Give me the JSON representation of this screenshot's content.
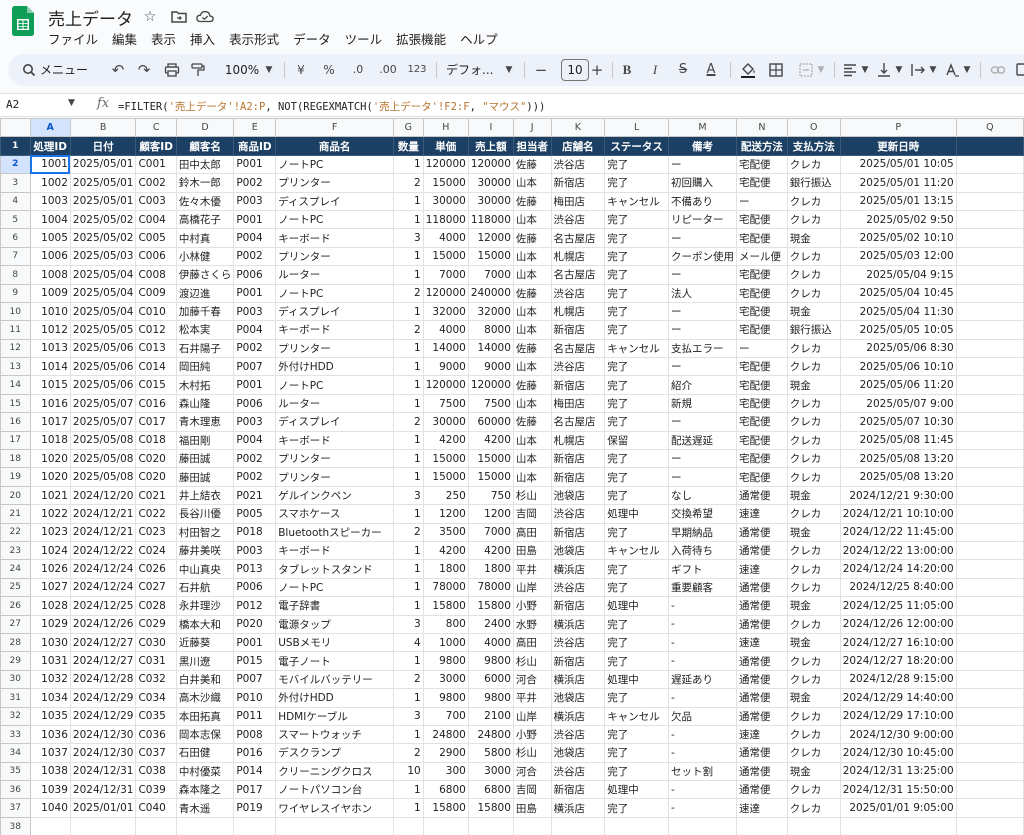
{
  "doc": {
    "title": "売上データ"
  },
  "menu": [
    "ファイル",
    "編集",
    "表示",
    "挿入",
    "表示形式",
    "データ",
    "ツール",
    "拡張機能",
    "ヘルプ"
  ],
  "toolbar": {
    "search_label": "メニュー",
    "zoom": "100%",
    "currency": "¥",
    "percent": "%",
    "dec_decrease": ".0",
    "dec_increase": ".00",
    "format_123": "123",
    "font": "デフォ...",
    "font_size": "10",
    "minus": "−",
    "plus": "+",
    "bold": "B",
    "italic": "I",
    "strike": "S",
    "text_color": "A"
  },
  "formula_bar": {
    "cell_ref": "A2",
    "fx": "fx",
    "formula_prefix": "=FILTER(",
    "formula_ref1": "'売上データ'!A2:P",
    "formula_mid": ", NOT(REGEXMATCH(",
    "formula_ref2": "'売上データ'!F2:F",
    "formula_sep": ", ",
    "formula_str": "\"マウス\"",
    "formula_end": ")))"
  },
  "columns": [
    "A",
    "B",
    "C",
    "D",
    "E",
    "F",
    "G",
    "H",
    "I",
    "J",
    "K",
    "L",
    "M",
    "N",
    "O",
    "P",
    "Q"
  ],
  "header_row": [
    "処理ID",
    "日付",
    "顧客ID",
    "顧客名",
    "商品ID",
    "商品名",
    "数量",
    "単価",
    "売上額",
    "担当者",
    "店舗名",
    "ステータス",
    "備考",
    "配送方法",
    "支払方法",
    "更新日時"
  ],
  "rows": [
    [
      "1001",
      "2025/05/01",
      "C001",
      "田中太郎",
      "P001",
      "ノートPC",
      "1",
      "120000",
      "120000",
      "佐藤",
      "渋谷店",
      "完了",
      "ー",
      "宅配便",
      "クレカ",
      "2025/05/01 10:05"
    ],
    [
      "1002",
      "2025/05/01",
      "C002",
      "鈴木一郎",
      "P002",
      "プリンター",
      "2",
      "15000",
      "30000",
      "山本",
      "新宿店",
      "完了",
      "初回購入",
      "宅配便",
      "銀行振込",
      "2025/05/01 11:20"
    ],
    [
      "1003",
      "2025/05/01",
      "C003",
      "佐々木優",
      "P003",
      "ディスプレイ",
      "1",
      "30000",
      "30000",
      "佐藤",
      "梅田店",
      "キャンセル",
      "不備あり",
      "ー",
      "クレカ",
      "2025/05/01 13:15"
    ],
    [
      "1004",
      "2025/05/02",
      "C004",
      "高橋花子",
      "P001",
      "ノートPC",
      "1",
      "118000",
      "118000",
      "山本",
      "渋谷店",
      "完了",
      "リピーター",
      "宅配便",
      "クレカ",
      "2025/05/02 9:50"
    ],
    [
      "1005",
      "2025/05/02",
      "C005",
      "中村真",
      "P004",
      "キーボード",
      "3",
      "4000",
      "12000",
      "佐藤",
      "名古屋店",
      "完了",
      "ー",
      "宅配便",
      "現金",
      "2025/05/02 10:10"
    ],
    [
      "1006",
      "2025/05/03",
      "C006",
      "小林健",
      "P002",
      "プリンター",
      "1",
      "15000",
      "15000",
      "山本",
      "札幌店",
      "完了",
      "クーポン使用",
      "メール便",
      "クレカ",
      "2025/05/03 12:00"
    ],
    [
      "1008",
      "2025/05/04",
      "C008",
      "伊藤さくら",
      "P006",
      "ルーター",
      "1",
      "7000",
      "7000",
      "山本",
      "名古屋店",
      "完了",
      "ー",
      "宅配便",
      "クレカ",
      "2025/05/04 9:15"
    ],
    [
      "1009",
      "2025/05/04",
      "C009",
      "渡辺進",
      "P001",
      "ノートPC",
      "2",
      "120000",
      "240000",
      "佐藤",
      "渋谷店",
      "完了",
      "法人",
      "宅配便",
      "クレカ",
      "2025/05/04 10:45"
    ],
    [
      "1010",
      "2025/05/04",
      "C010",
      "加藤千春",
      "P003",
      "ディスプレイ",
      "1",
      "32000",
      "32000",
      "山本",
      "札幌店",
      "完了",
      "ー",
      "宅配便",
      "現金",
      "2025/05/04 11:30"
    ],
    [
      "1012",
      "2025/05/05",
      "C012",
      "松本実",
      "P004",
      "キーボード",
      "2",
      "4000",
      "8000",
      "山本",
      "新宿店",
      "完了",
      "ー",
      "宅配便",
      "銀行振込",
      "2025/05/05 10:05"
    ],
    [
      "1013",
      "2025/05/06",
      "C013",
      "石井陽子",
      "P002",
      "プリンター",
      "1",
      "14000",
      "14000",
      "佐藤",
      "名古屋店",
      "キャンセル",
      "支払エラー",
      "ー",
      "クレカ",
      "2025/05/06 8:30"
    ],
    [
      "1014",
      "2025/05/06",
      "C014",
      "岡田純",
      "P007",
      "外付けHDD",
      "1",
      "9000",
      "9000",
      "山本",
      "渋谷店",
      "完了",
      "ー",
      "宅配便",
      "クレカ",
      "2025/05/06 10:10"
    ],
    [
      "1015",
      "2025/05/06",
      "C015",
      "木村拓",
      "P001",
      "ノートPC",
      "1",
      "120000",
      "120000",
      "佐藤",
      "新宿店",
      "完了",
      "紹介",
      "宅配便",
      "現金",
      "2025/05/06 11:20"
    ],
    [
      "1016",
      "2025/05/07",
      "C016",
      "森山隆",
      "P006",
      "ルーター",
      "1",
      "7500",
      "7500",
      "山本",
      "梅田店",
      "完了",
      "新規",
      "宅配便",
      "クレカ",
      "2025/05/07 9:00"
    ],
    [
      "1017",
      "2025/05/07",
      "C017",
      "青木理恵",
      "P003",
      "ディスプレイ",
      "2",
      "30000",
      "60000",
      "佐藤",
      "名古屋店",
      "完了",
      "ー",
      "宅配便",
      "クレカ",
      "2025/05/07 10:30"
    ],
    [
      "1018",
      "2025/05/08",
      "C018",
      "福田剛",
      "P004",
      "キーボード",
      "1",
      "4200",
      "4200",
      "山本",
      "札幌店",
      "保留",
      "配送遅延",
      "宅配便",
      "クレカ",
      "2025/05/08 11:45"
    ],
    [
      "1020",
      "2025/05/08",
      "C020",
      "藤田誠",
      "P002",
      "プリンター",
      "1",
      "15000",
      "15000",
      "山本",
      "新宿店",
      "完了",
      "ー",
      "宅配便",
      "クレカ",
      "2025/05/08 13:20"
    ],
    [
      "1020",
      "2025/05/08",
      "C020",
      "藤田誠",
      "P002",
      "プリンター",
      "1",
      "15000",
      "15000",
      "山本",
      "新宿店",
      "完了",
      "ー",
      "宅配便",
      "クレカ",
      "2025/05/08 13:20"
    ],
    [
      "1021",
      "2024/12/20",
      "C021",
      "井上結衣",
      "P021",
      "ゲルインクペン",
      "3",
      "250",
      "750",
      "杉山",
      "池袋店",
      "完了",
      "なし",
      "通常便",
      "現金",
      "2024/12/21 9:30:00"
    ],
    [
      "1022",
      "2024/12/21",
      "C022",
      "長谷川優",
      "P005",
      "スマホケース",
      "1",
      "1200",
      "1200",
      "吉岡",
      "渋谷店",
      "処理中",
      "交換希望",
      "速達",
      "クレカ",
      "2024/12/21 10:10:00"
    ],
    [
      "1023",
      "2024/12/21",
      "C023",
      "村田智之",
      "P018",
      "Bluetoothスピーカー",
      "2",
      "3500",
      "7000",
      "高田",
      "新宿店",
      "完了",
      "早期納品",
      "通常便",
      "現金",
      "2024/12/22 11:45:00"
    ],
    [
      "1024",
      "2024/12/22",
      "C024",
      "藤井美咲",
      "P003",
      "キーボード",
      "1",
      "4200",
      "4200",
      "田島",
      "池袋店",
      "キャンセル",
      "入荷待ち",
      "通常便",
      "クレカ",
      "2024/12/22 13:00:00"
    ],
    [
      "1026",
      "2024/12/24",
      "C026",
      "中山真央",
      "P013",
      "タブレットスタンド",
      "1",
      "1800",
      "1800",
      "平井",
      "横浜店",
      "完了",
      "ギフト",
      "速達",
      "クレカ",
      "2024/12/24 14:20:00"
    ],
    [
      "1027",
      "2024/12/24",
      "C027",
      "石井航",
      "P006",
      "ノートPC",
      "1",
      "78000",
      "78000",
      "山岸",
      "渋谷店",
      "完了",
      "重要顧客",
      "通常便",
      "クレカ",
      "2024/12/25 8:40:00"
    ],
    [
      "1028",
      "2024/12/25",
      "C028",
      "永井理沙",
      "P012",
      "電子辞書",
      "1",
      "15800",
      "15800",
      "小野",
      "新宿店",
      "処理中",
      "-",
      "通常便",
      "現金",
      "2024/12/25 11:05:00"
    ],
    [
      "1029",
      "2024/12/26",
      "C029",
      "橋本大和",
      "P020",
      "電源タップ",
      "3",
      "800",
      "2400",
      "水野",
      "横浜店",
      "完了",
      "-",
      "通常便",
      "クレカ",
      "2024/12/26 12:00:00"
    ],
    [
      "1030",
      "2024/12/27",
      "C030",
      "近藤葵",
      "P001",
      "USBメモリ",
      "4",
      "1000",
      "4000",
      "高田",
      "渋谷店",
      "完了",
      "-",
      "速達",
      "現金",
      "2024/12/27 16:10:00"
    ],
    [
      "1031",
      "2024/12/27",
      "C031",
      "黒川遼",
      "P015",
      "電子ノート",
      "1",
      "9800",
      "9800",
      "杉山",
      "新宿店",
      "完了",
      "-",
      "通常便",
      "クレカ",
      "2024/12/27 18:20:00"
    ],
    [
      "1032",
      "2024/12/28",
      "C032",
      "白井美和",
      "P007",
      "モバイルバッテリー",
      "2",
      "3000",
      "6000",
      "河合",
      "横浜店",
      "処理中",
      "遅延あり",
      "通常便",
      "クレカ",
      "2024/12/28 9:15:00"
    ],
    [
      "1034",
      "2024/12/29",
      "C034",
      "高木沙織",
      "P010",
      "外付けHDD",
      "1",
      "9800",
      "9800",
      "平井",
      "池袋店",
      "完了",
      "-",
      "通常便",
      "現金",
      "2024/12/29 14:40:00"
    ],
    [
      "1035",
      "2024/12/29",
      "C035",
      "本田拓真",
      "P011",
      "HDMIケーブル",
      "3",
      "700",
      "2100",
      "山岸",
      "横浜店",
      "キャンセル",
      "欠品",
      "通常便",
      "クレカ",
      "2024/12/29 17:10:00"
    ],
    [
      "1036",
      "2024/12/30",
      "C036",
      "岡本志保",
      "P008",
      "スマートウォッチ",
      "1",
      "24800",
      "24800",
      "小野",
      "渋谷店",
      "完了",
      "-",
      "速達",
      "クレカ",
      "2024/12/30 9:00:00"
    ],
    [
      "1037",
      "2024/12/30",
      "C037",
      "石田健",
      "P016",
      "デスクランプ",
      "2",
      "2900",
      "5800",
      "杉山",
      "池袋店",
      "完了",
      "-",
      "通常便",
      "クレカ",
      "2024/12/30 10:45:00"
    ],
    [
      "1038",
      "2024/12/31",
      "C038",
      "中村優菜",
      "P014",
      "クリーニングクロス",
      "10",
      "300",
      "3000",
      "河合",
      "渋谷店",
      "完了",
      "セット割",
      "通常便",
      "現金",
      "2024/12/31 13:25:00"
    ],
    [
      "1039",
      "2024/12/31",
      "C039",
      "森本隆之",
      "P017",
      "ノートパソコン台",
      "1",
      "6800",
      "6800",
      "吉岡",
      "新宿店",
      "処理中",
      "-",
      "通常便",
      "クレカ",
      "2024/12/31 15:50:00"
    ],
    [
      "1040",
      "2025/01/01",
      "C040",
      "青木遥",
      "P019",
      "ワイヤレスイヤホン",
      "1",
      "15800",
      "15800",
      "田島",
      "横浜店",
      "完了",
      "-",
      "速達",
      "クレカ",
      "2025/01/01 9:05:00"
    ]
  ],
  "colors": {
    "header_bg": "#1c4064",
    "header_text": "#ffffff",
    "selection": "#1a73e8"
  }
}
